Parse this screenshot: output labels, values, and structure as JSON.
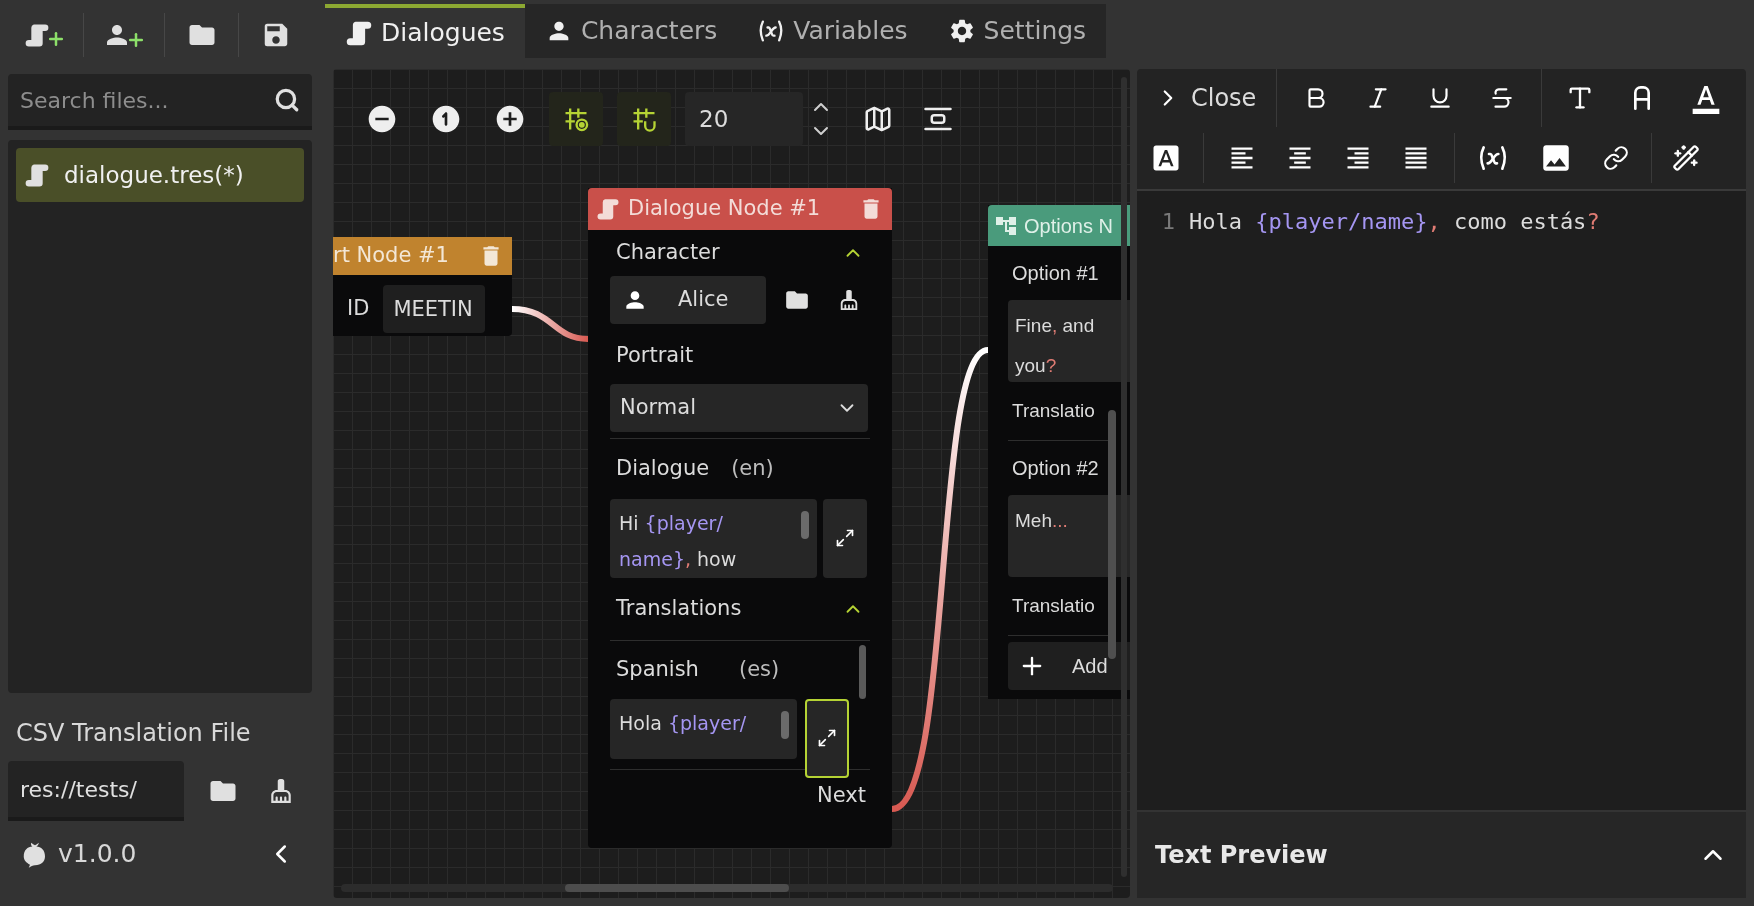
{
  "sidebar": {
    "search": {
      "placeholder": "Search files..."
    },
    "files": [
      {
        "name": "dialogue.tres(*)",
        "selected": true
      }
    ],
    "translation_file": {
      "label": "CSV Translation File",
      "value": "res://tests/"
    },
    "version": "v1.0.0"
  },
  "tabs": [
    {
      "label": "Dialogues",
      "kind": "dialogues",
      "selected": true
    },
    {
      "label": "Characters",
      "kind": "characters",
      "selected": false
    },
    {
      "label": "Variables",
      "kind": "variables",
      "selected": false
    },
    {
      "label": "Settings",
      "kind": "settings",
      "selected": false
    }
  ],
  "graph": {
    "zoom_step": "20",
    "start_node": {
      "title": "rt Node #1",
      "id_label": "ID",
      "id_value": "MEETIN"
    },
    "dialogue_node": {
      "title": "Dialogue Node #1",
      "character": {
        "label": "Character",
        "expanded": true,
        "value": "Alice"
      },
      "portrait": {
        "label": "Portrait",
        "value": "Normal"
      },
      "dialogue": {
        "label": "Dialogue",
        "lang": "(en)",
        "focused": false,
        "lines": [
          [
            {
              "kind": "text",
              "text": "Hi "
            },
            {
              "kind": "variable",
              "text": "{player/"
            }
          ],
          [
            {
              "kind": "variable",
              "text": "name}"
            },
            {
              "kind": "symbol",
              "text": ","
            },
            {
              "kind": "text",
              "text": " how"
            }
          ]
        ]
      },
      "translations": {
        "label": "Translations",
        "expanded": true,
        "items": [
          {
            "language": "Spanish",
            "lang": "(es)",
            "focused": true,
            "lines": [
              [
                {
                  "kind": "text",
                  "text": "Hola "
                },
                {
                  "kind": "variable",
                  "text": "{player/"
                }
              ]
            ]
          }
        ]
      },
      "output": "Next"
    },
    "options_node": {
      "title": "Options N",
      "options": [
        {
          "label": "Option #1",
          "translation_label": "Translatio",
          "lines": [
            [
              {
                "kind": "text",
                "text": "Fine"
              },
              {
                "kind": "symbol",
                "text": ","
              },
              {
                "kind": "text",
                "text": " and"
              }
            ],
            [
              {
                "kind": "text",
                "text": "you"
              },
              {
                "kind": "symbol",
                "text": "?"
              }
            ]
          ]
        },
        {
          "label": "Option #2",
          "translation_label": "Translatio",
          "lines": [
            [
              {
                "kind": "text",
                "text": "Meh"
              },
              {
                "kind": "symbol",
                "text": "..."
              }
            ]
          ]
        }
      ],
      "add_label": "Add"
    }
  },
  "editor": {
    "close_label": "Close",
    "lines": [
      {
        "number": "1",
        "segments": [
          {
            "kind": "text",
            "text": "Hola "
          },
          {
            "kind": "variable",
            "text": "{player/name}"
          },
          {
            "kind": "symbol",
            "text": ","
          },
          {
            "kind": "text",
            "text": " como estás"
          },
          {
            "kind": "symbol",
            "text": "?"
          }
        ]
      }
    ],
    "preview": {
      "title": "Text Preview",
      "expanded": false
    }
  }
}
